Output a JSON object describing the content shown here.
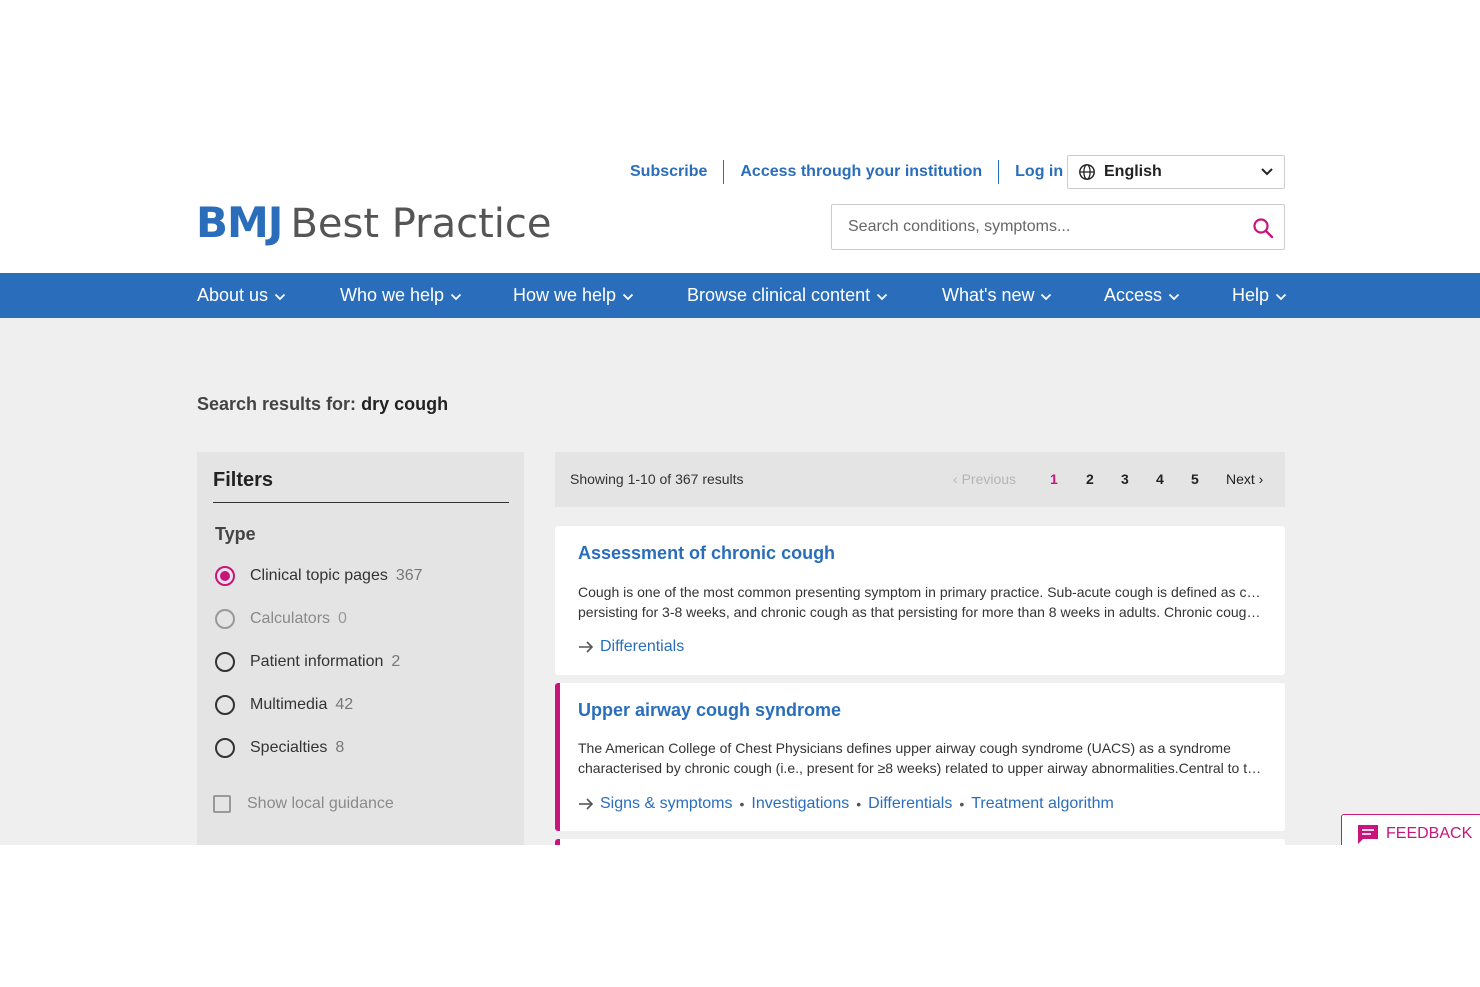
{
  "header": {
    "logo_bmj": "BMJ",
    "logo_name": "Best Practice",
    "util_links": [
      "Subscribe",
      "Access through your institution",
      "Log in"
    ],
    "language": "English",
    "search_placeholder": "Search conditions, symptoms..."
  },
  "nav": {
    "items": [
      "About us",
      "Who we help",
      "How we help",
      "Browse clinical content",
      "What's new",
      "Access",
      "Help"
    ]
  },
  "results": {
    "heading_label": "Search results for:",
    "query": "dry cough"
  },
  "filters": {
    "title": "Filters",
    "type_title": "Type",
    "options": [
      {
        "label": "Clinical topic pages",
        "count": "367",
        "state": "checked"
      },
      {
        "label": "Calculators",
        "count": "0",
        "state": "disabled"
      },
      {
        "label": "Patient information",
        "count": "2",
        "state": "unchecked"
      },
      {
        "label": "Multimedia",
        "count": "42",
        "state": "unchecked"
      },
      {
        "label": "Specialties",
        "count": "8",
        "state": "unchecked"
      }
    ],
    "local_guidance": "Show local guidance"
  },
  "pager": {
    "showing": "Showing 1-10 of 367 results",
    "previous": "Previous",
    "pages": [
      "1",
      "2",
      "3",
      "4",
      "5"
    ],
    "active_page": "1",
    "next": "Next"
  },
  "cards": [
    {
      "title": "Assessment of chronic cough",
      "desc_line1": "Cough is one of the most common presenting symptom in primary practice. Sub-acute cough is defined as cough",
      "desc_line2": "persisting for 3-8 weeks, and chronic cough as that persisting for more than 8 weeks in adults.  Chronic cough is a common problem...",
      "links": [
        "Differentials"
      ]
    },
    {
      "title": "Upper airway cough syndrome",
      "desc_line1": "The American College of Chest Physicians defines upper airway cough syndrome (UACS) as a syndrome",
      "desc_line2": "characterised by chronic cough (i.e., present for ≥8 weeks) related to upper airway abnormalities.Central to the diagnosis...",
      "links": [
        "Signs & symptoms",
        "Investigations",
        "Differentials",
        "Treatment algorithm"
      ]
    }
  ],
  "feedback": "FEEDBACK",
  "colors": {
    "brand_blue": "#2a6ebb",
    "accent_magenta": "#c8157e",
    "panel_grey": "#e4e4e4"
  }
}
